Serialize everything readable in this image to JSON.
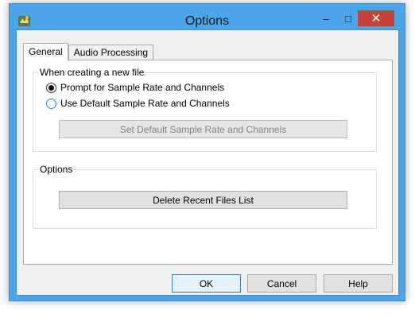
{
  "window": {
    "title": "Options",
    "minimize_glyph": "–",
    "maximize_glyph": "□",
    "close_glyph": "✕",
    "accent_color": "#4aa6e8"
  },
  "tabs": [
    {
      "label": "General",
      "active": true
    },
    {
      "label": "Audio Processing",
      "active": false
    }
  ],
  "general": {
    "new_file_group": {
      "label": "When creating a new file",
      "options": [
        {
          "label": "Prompt for Sample Rate and Channels",
          "checked": true
        },
        {
          "label": "Use Default Sample Rate and Channels",
          "checked": false
        }
      ],
      "set_default_button": "Set Default Sample Rate and Channels"
    },
    "options_group": {
      "label": "Options",
      "delete_recent_button": "Delete Recent Files List"
    }
  },
  "footer": {
    "ok_label": "OK",
    "cancel_label": "Cancel",
    "help_label": "Help"
  }
}
